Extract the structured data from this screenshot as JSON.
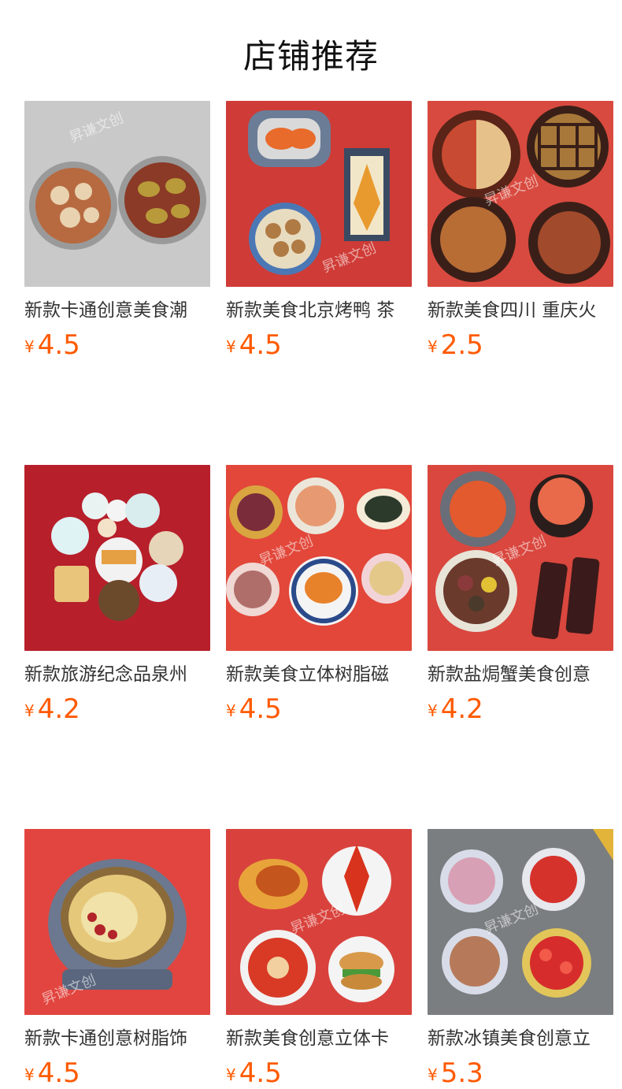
{
  "header": {
    "title": "店铺推荐"
  },
  "products": [
    {
      "title": "新款卡通创意美食潮",
      "currency": "¥",
      "price": "4.5",
      "bg": "#c9c9c9"
    },
    {
      "title": "新款美食北京烤鸭 茶",
      "currency": "¥",
      "price": "4.5",
      "bg": "#cf3b36"
    },
    {
      "title": "新款美食四川 重庆火",
      "currency": "¥",
      "price": "2.5",
      "bg": "#d84a3f"
    },
    {
      "title": "新款旅游纪念品泉州",
      "currency": "¥",
      "price": "4.2",
      "bg": "#b71f2b"
    },
    {
      "title": "新款美食立体树脂磁",
      "currency": "¥",
      "price": "4.5",
      "bg": "#e2473a"
    },
    {
      "title": "新款盐焗蟹美食创意",
      "currency": "¥",
      "price": "4.2",
      "bg": "#d9473e"
    },
    {
      "title": "新款卡通创意树脂饰",
      "currency": "¥",
      "price": "4.5",
      "bg": "#e2453f"
    },
    {
      "title": "新款美食创意立体卡",
      "currency": "¥",
      "price": "4.5",
      "bg": "#d9423c"
    },
    {
      "title": "新款冰镇美食创意立",
      "currency": "¥",
      "price": "5.3",
      "bg": "#7a7e80"
    }
  ],
  "watermark": "昇谦文创"
}
